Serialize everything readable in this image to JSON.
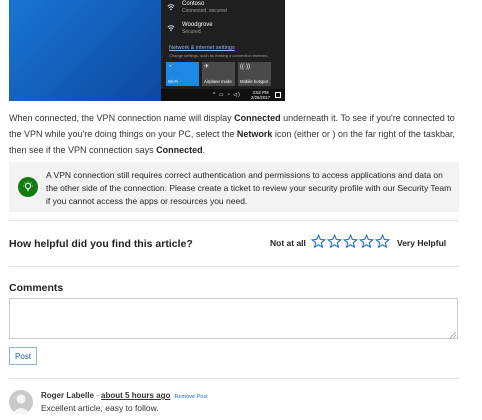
{
  "screenshot": {
    "networks": [
      {
        "name": "Contoso",
        "status": "Connected, secured"
      },
      {
        "name": "Woodgrove",
        "status": "Secured"
      }
    ],
    "settings_link": "Network & internet settings",
    "settings_sub": "Change settings, such as making a connection metered.",
    "tiles": [
      {
        "label": "Wi-Fi",
        "icon": "wifi-icon"
      },
      {
        "label": "Airplane mode",
        "icon": "airplane-icon"
      },
      {
        "label": "Mobile hotspot",
        "icon": "hotspot-icon"
      }
    ],
    "clock_time": "3:52 PM",
    "clock_date": "2/25/2017"
  },
  "article": {
    "para_1": "When connected, the VPN connection name will display ",
    "para_bold_1": "Connected",
    "para_2": " underneath it. To see if you're connected to the VPN while you're doing things on your PC, select the ",
    "para_bold_2": "Network",
    "para_3": " icon (either  or ) on the far right of the taskbar, then see if the VPN connection says ",
    "para_bold_3": "Connected",
    "para_4": ".",
    "info_text": "A VPN connection still requires correct authentication and permissions to access applications and data on the other side of the connection.  Please create a ticket to review your security profile with our Security Team if you cannot access the apps or resources you need.",
    "info_color": "#107c10"
  },
  "rating": {
    "question": "How helpful did you find this article?",
    "low_label": "Not at all",
    "high_label": "Very Helpful",
    "star_count": 5,
    "star_color": "#1e6fd9"
  },
  "comments": {
    "heading": "Comments",
    "post_label": "Post",
    "items": [
      {
        "author": "Roger Labelle",
        "separator": "-",
        "time": "about 5 hours ago",
        "action": "Remove Post",
        "text": "Excellent article, easy to follow."
      }
    ]
  }
}
